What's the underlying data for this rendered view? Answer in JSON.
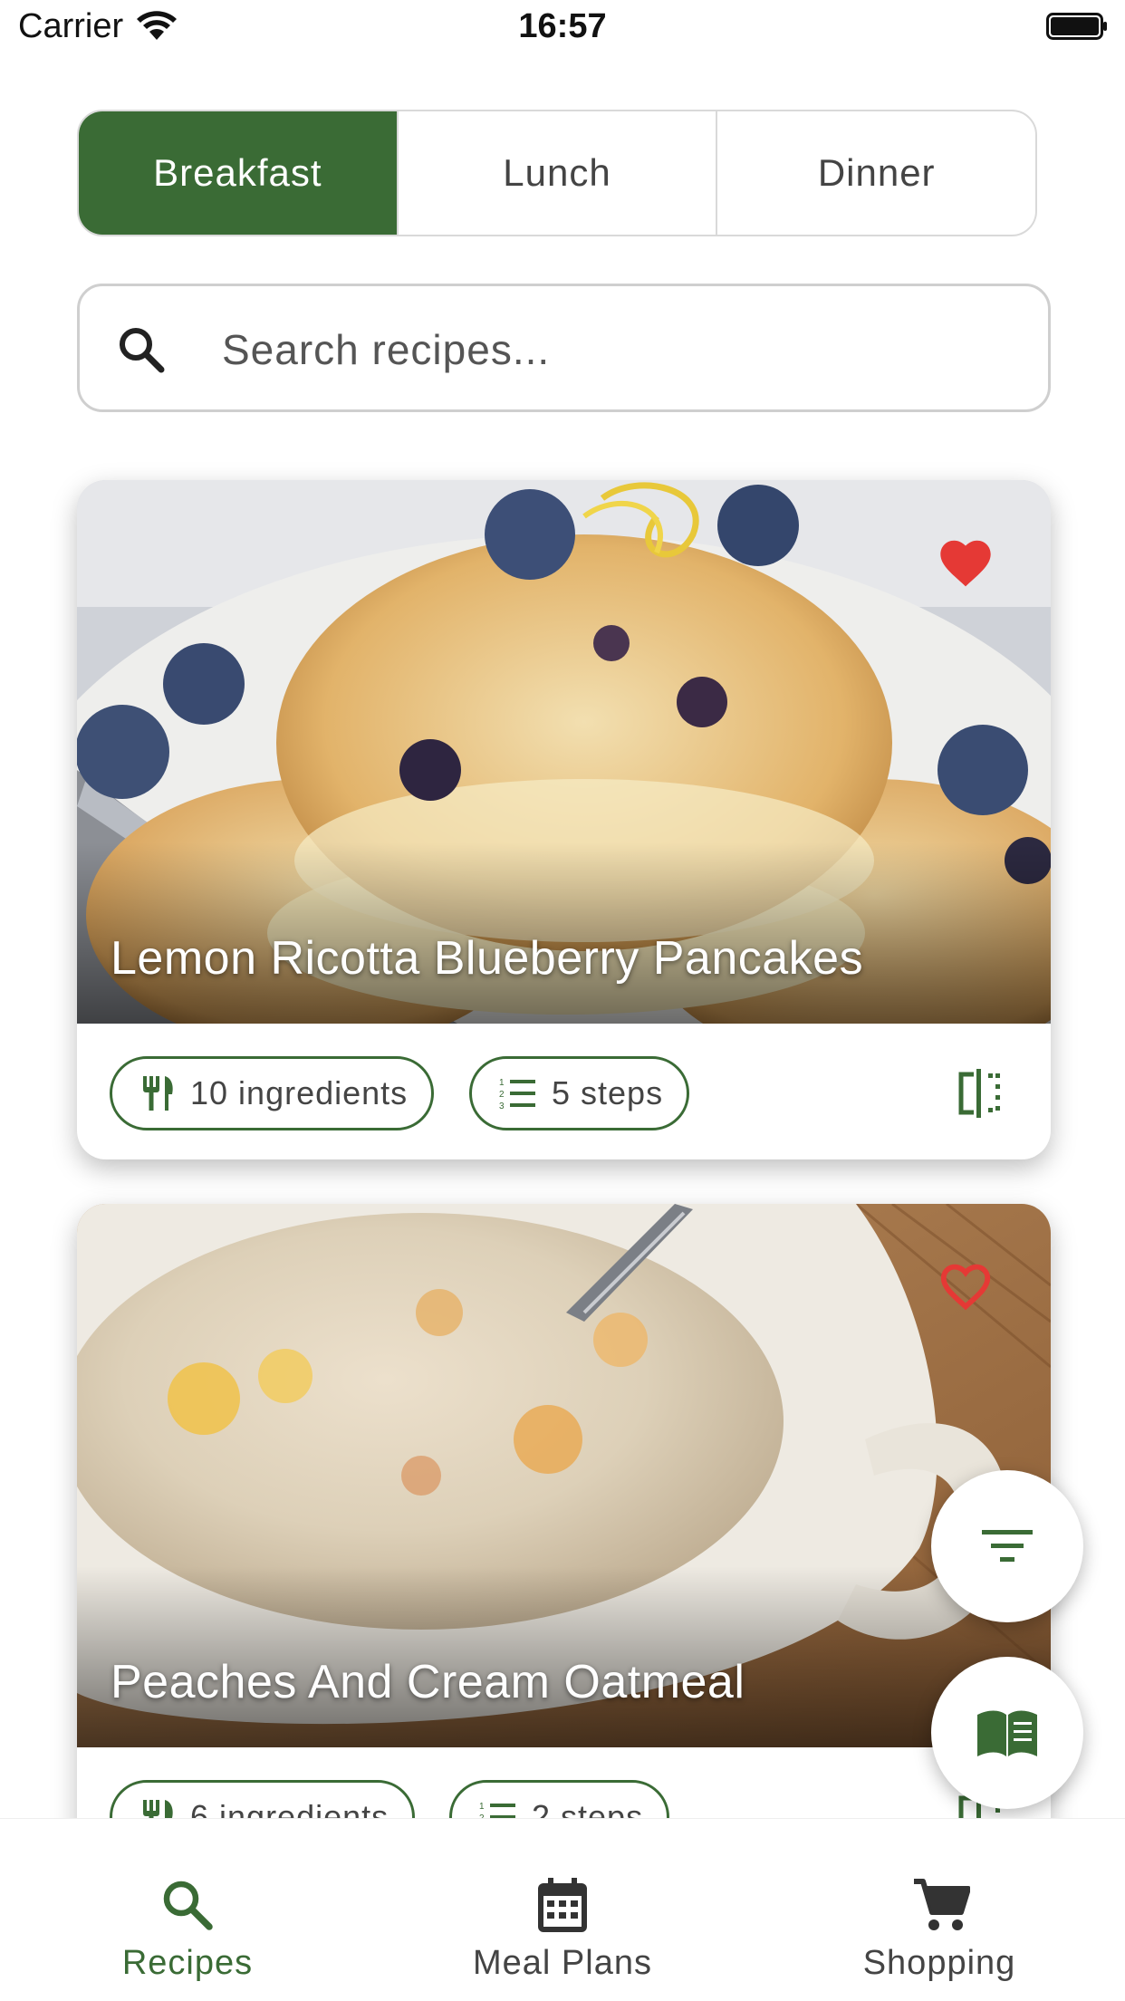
{
  "status_bar": {
    "carrier": "Carrier",
    "time": "16:57"
  },
  "segments": [
    {
      "label": "Breakfast",
      "selected": true
    },
    {
      "label": "Lunch",
      "selected": false
    },
    {
      "label": "Dinner",
      "selected": false
    }
  ],
  "search": {
    "placeholder": "Search recipes...",
    "value": ""
  },
  "recipes": [
    {
      "title": "Lemon Ricotta Blueberry Pancakes",
      "ingredients": "10 ingredients",
      "steps": "5 steps",
      "favorite": true
    },
    {
      "title": "Peaches And Cream Oatmeal",
      "ingredients": "6 ingredients",
      "steps": "2 steps",
      "favorite": false
    }
  ],
  "fabs": {
    "filter_icon": "filter-icon",
    "book_icon": "book-icon"
  },
  "bottom_nav": [
    {
      "label": "Recipes",
      "icon": "search-icon",
      "active": true
    },
    {
      "label": "Meal Plans",
      "icon": "calendar-icon",
      "active": false
    },
    {
      "label": "Shopping",
      "icon": "cart-icon",
      "active": false
    }
  ],
  "colors": {
    "accent": "#3a6b35",
    "favorite": "#e53935"
  }
}
